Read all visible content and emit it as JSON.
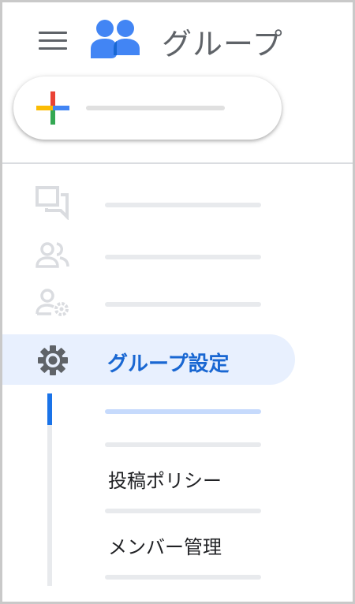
{
  "header": {
    "app_title": "グループ",
    "menu_icon": "hamburger-menu-icon",
    "logo_icon": "google-groups-logo-icon"
  },
  "create_button": {
    "icon": "plus-multicolor-icon",
    "colors": {
      "red": "#ea4335",
      "blue": "#4285f4",
      "green": "#34a853",
      "yellow": "#fbbc04"
    }
  },
  "nav": {
    "items": [
      {
        "icon": "conversations-icon"
      },
      {
        "icon": "people-icon"
      },
      {
        "icon": "person-settings-icon"
      },
      {
        "icon": "gear-icon",
        "label": "グループ設定",
        "active": true
      }
    ]
  },
  "subnav": {
    "items": [
      {
        "selected": true
      },
      {
        "label": "投稿ポリシー"
      },
      {
        "label": "メンバー管理"
      }
    ]
  },
  "colors": {
    "accent": "#1967d2",
    "active_background": "#e8f0fe",
    "icon_gray": "#5f6368",
    "muted_icon": "#dadce0"
  }
}
